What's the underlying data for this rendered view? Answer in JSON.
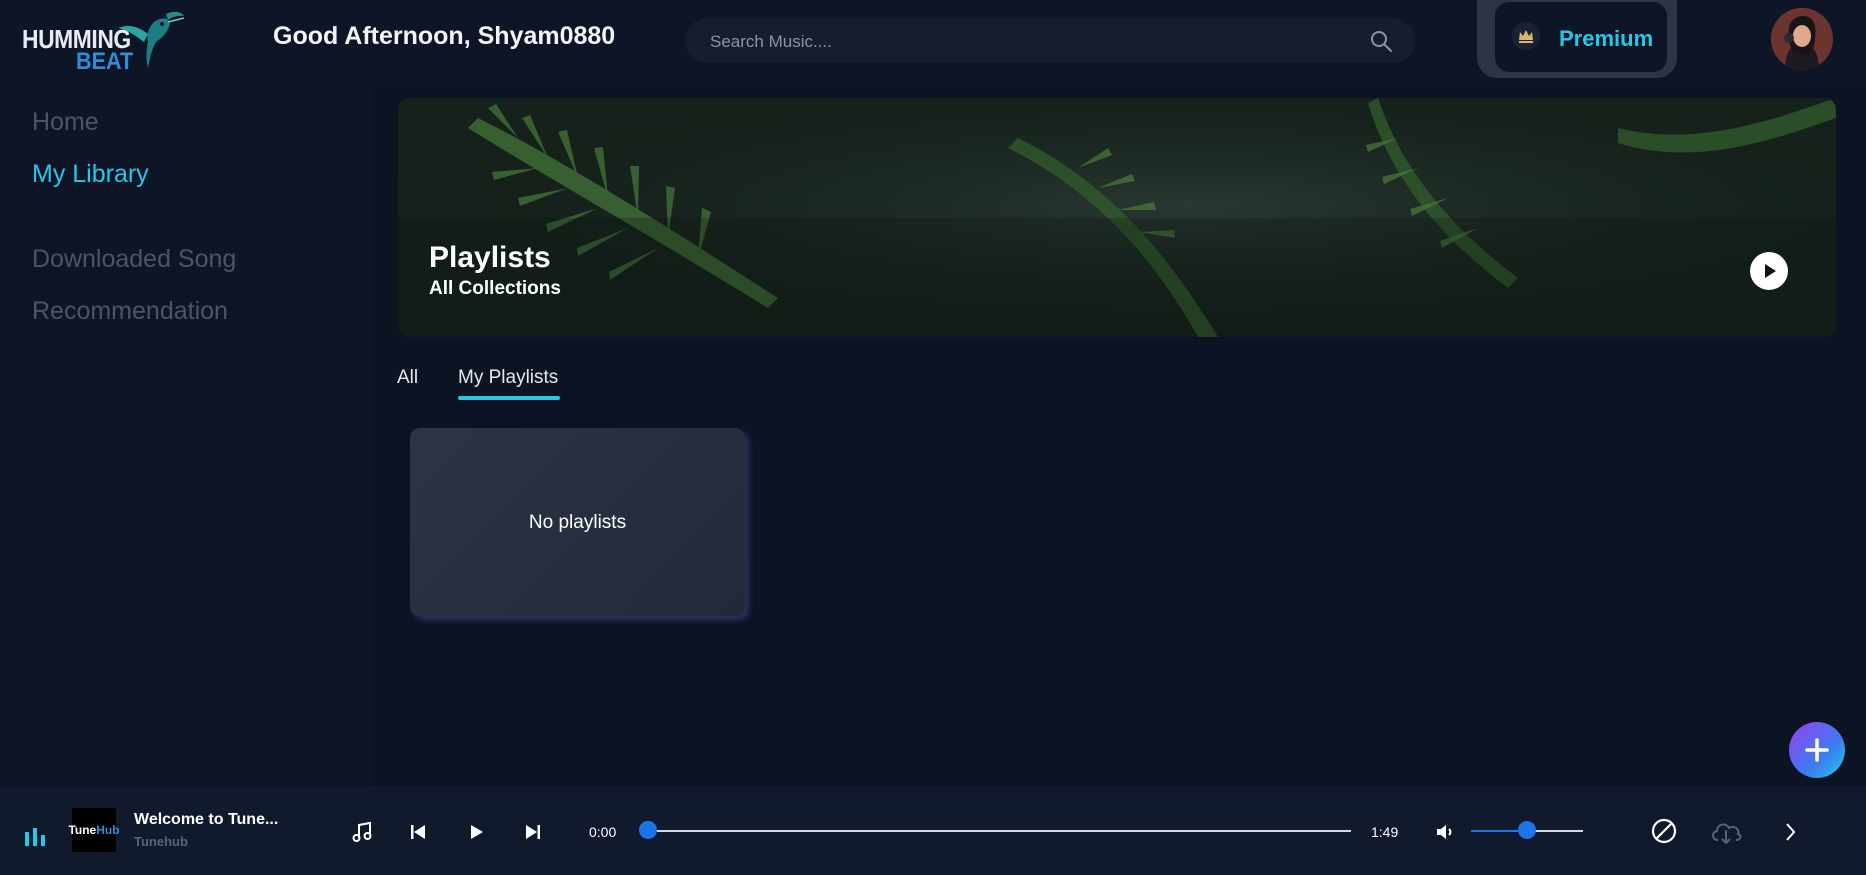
{
  "app": {
    "logo_line1": "HUMMING",
    "logo_line2": "BEAT",
    "greeting": "Good Afternoon, Shyam0880"
  },
  "search": {
    "placeholder": "Search Music...."
  },
  "premium": {
    "label": "Premium"
  },
  "sidebar": {
    "items": [
      {
        "label": "Home",
        "active": false
      },
      {
        "label": "My Library",
        "active": true
      },
      {
        "label": "Downloaded Song",
        "active": false
      },
      {
        "label": "Recommendation",
        "active": false
      }
    ]
  },
  "banner": {
    "title": "Playlists",
    "subtitle": "All Collections"
  },
  "tabs": [
    {
      "label": "All",
      "active": false
    },
    {
      "label": "My Playlists",
      "active": true
    }
  ],
  "empty_state": {
    "text": "No playlists"
  },
  "player": {
    "thumb_text_1": "Tune",
    "thumb_text_2": "Hub",
    "title": "Welcome to Tune...",
    "artist": "Tunehub",
    "current_time": "0:00",
    "duration": "1:49",
    "progress": 0,
    "volume": 0.5
  },
  "colors": {
    "accent": "#29c7e6",
    "primary_blue": "#1b74e8",
    "background": "#0c1322",
    "surface": "#0e1526"
  }
}
